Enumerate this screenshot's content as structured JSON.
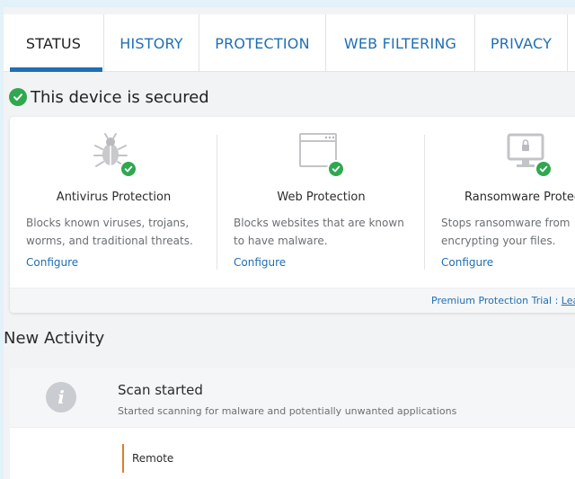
{
  "tabs": [
    {
      "label": "STATUS",
      "active": true
    },
    {
      "label": "HISTORY",
      "active": false
    },
    {
      "label": "PROTECTION",
      "active": false
    },
    {
      "label": "WEB FILTERING",
      "active": false
    },
    {
      "label": "PRIVACY",
      "active": false
    }
  ],
  "status": {
    "title": "This device is secured",
    "icon": "check-circle-icon"
  },
  "cards": [
    {
      "title": "Antivirus Protection",
      "description": "Blocks known viruses, trojans, worms, and traditional threats.",
      "link": "Configure",
      "icon": "bug-icon"
    },
    {
      "title": "Web Protection",
      "description": "Blocks websites that are known to have malware.",
      "link": "Configure",
      "icon": "browser-window-icon"
    },
    {
      "title": "Ransomware Protection",
      "description": "Stops ransomware from encrypting your files.",
      "link": "Configure",
      "icon": "locked-monitor-icon"
    }
  ],
  "trial": {
    "text": "Premium Protection Trial : ",
    "link": "Learn More"
  },
  "activity": {
    "section_title": "New Activity",
    "items": [
      {
        "title": "Scan started",
        "description": "Started scanning for malware and potentially unwanted applications",
        "icon": "info-icon",
        "source": "Remote"
      }
    ]
  },
  "colors": {
    "accent": "#1f6fb3",
    "success": "#2fa84f",
    "remote_marker": "#e07a2e",
    "background": "#e3f1f9"
  }
}
